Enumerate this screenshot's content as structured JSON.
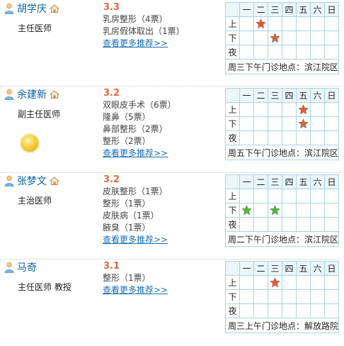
{
  "schedule_header": [
    "一",
    "二",
    "三",
    "四",
    "五",
    "六",
    "日"
  ],
  "period_labels": [
    "上",
    "下",
    "夜"
  ],
  "more_label": "查看更多推荐>>",
  "colors": {
    "star_red": "#e8553c",
    "star_brown": "#c86a4a",
    "star_green": "#3fbf3f",
    "link": "#1a6fb5",
    "score": "#e06a3a"
  },
  "doctors": [
    {
      "name": "胡学庆",
      "title": "主任医师",
      "score": "3.3",
      "tags": [
        "乳房整形（4票）",
        "乳房假体取出（1票）"
      ],
      "clinic": "周三下午门诊地点：滨江院区",
      "stars": [
        {
          "period": 0,
          "day": 1,
          "color": "star_red"
        },
        {
          "period": 1,
          "day": 2,
          "color": "star_brown"
        }
      ]
    },
    {
      "name": "余建新",
      "title": "副主任医师",
      "score": "3.2",
      "tags": [
        "双眼皮手术（6票）",
        "隆鼻（5票）",
        "鼻部整形（2票）",
        "整形（2票）"
      ],
      "clinic": "周五下午门诊地点：滨江院区",
      "stars": [
        {
          "period": 0,
          "day": 4,
          "color": "star_red"
        },
        {
          "period": 1,
          "day": 4,
          "color": "star_brown"
        }
      ]
    },
    {
      "name": "张梦文",
      "title": "主治医师",
      "score": "3.2",
      "tags": [
        "皮肤整形（1票）",
        "整形（1票）",
        "皮肤病（1票）",
        "腋臭（1票）"
      ],
      "clinic": "周二下午门诊地点：滨江院区",
      "stars": [
        {
          "period": 1,
          "day": 0,
          "color": "star_green"
        },
        {
          "period": 1,
          "day": 2,
          "color": "star_green"
        }
      ]
    },
    {
      "name": "马奇",
      "title": "主任医师 教授",
      "score": "3.1",
      "tags": [
        "整形（1票）"
      ],
      "clinic": "周三上午门诊地点：解放路院",
      "stars": [
        {
          "period": 0,
          "day": 2,
          "color": "star_red"
        }
      ]
    }
  ]
}
